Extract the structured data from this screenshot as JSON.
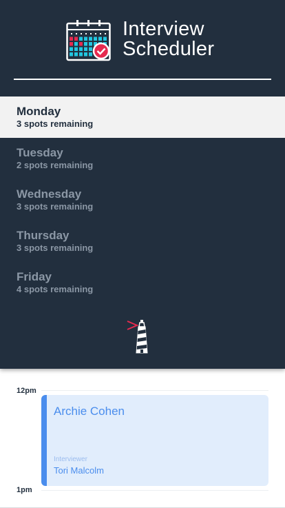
{
  "app": {
    "title_line1": "Interview",
    "title_line2": "Scheduler",
    "logo_icon": "calendar-check-icon",
    "footer_icon": "lighthouse-icon"
  },
  "days": [
    {
      "name": "Monday",
      "spots": "3 spots remaining",
      "selected": true
    },
    {
      "name": "Tuesday",
      "spots": "2 spots remaining",
      "selected": false
    },
    {
      "name": "Wednesday",
      "spots": "3 spots remaining",
      "selected": false
    },
    {
      "name": "Thursday",
      "spots": "3 spots remaining",
      "selected": false
    },
    {
      "name": "Friday",
      "spots": "4 spots remaining",
      "selected": false
    }
  ],
  "schedule": {
    "times": [
      "12pm",
      "1pm"
    ],
    "appointment": {
      "student": "Archie Cohen",
      "interviewer_label": "Interviewer",
      "interviewer": "Tori Malcolm"
    }
  },
  "colors": {
    "nav_bg": "#222f3e",
    "selected_bg": "#f2f2f2",
    "accent_blue": "#4a8ded",
    "appointment_bg": "#e1edfc",
    "check_red": "#e62a4f",
    "grid_cyan": "#22c6e0"
  }
}
